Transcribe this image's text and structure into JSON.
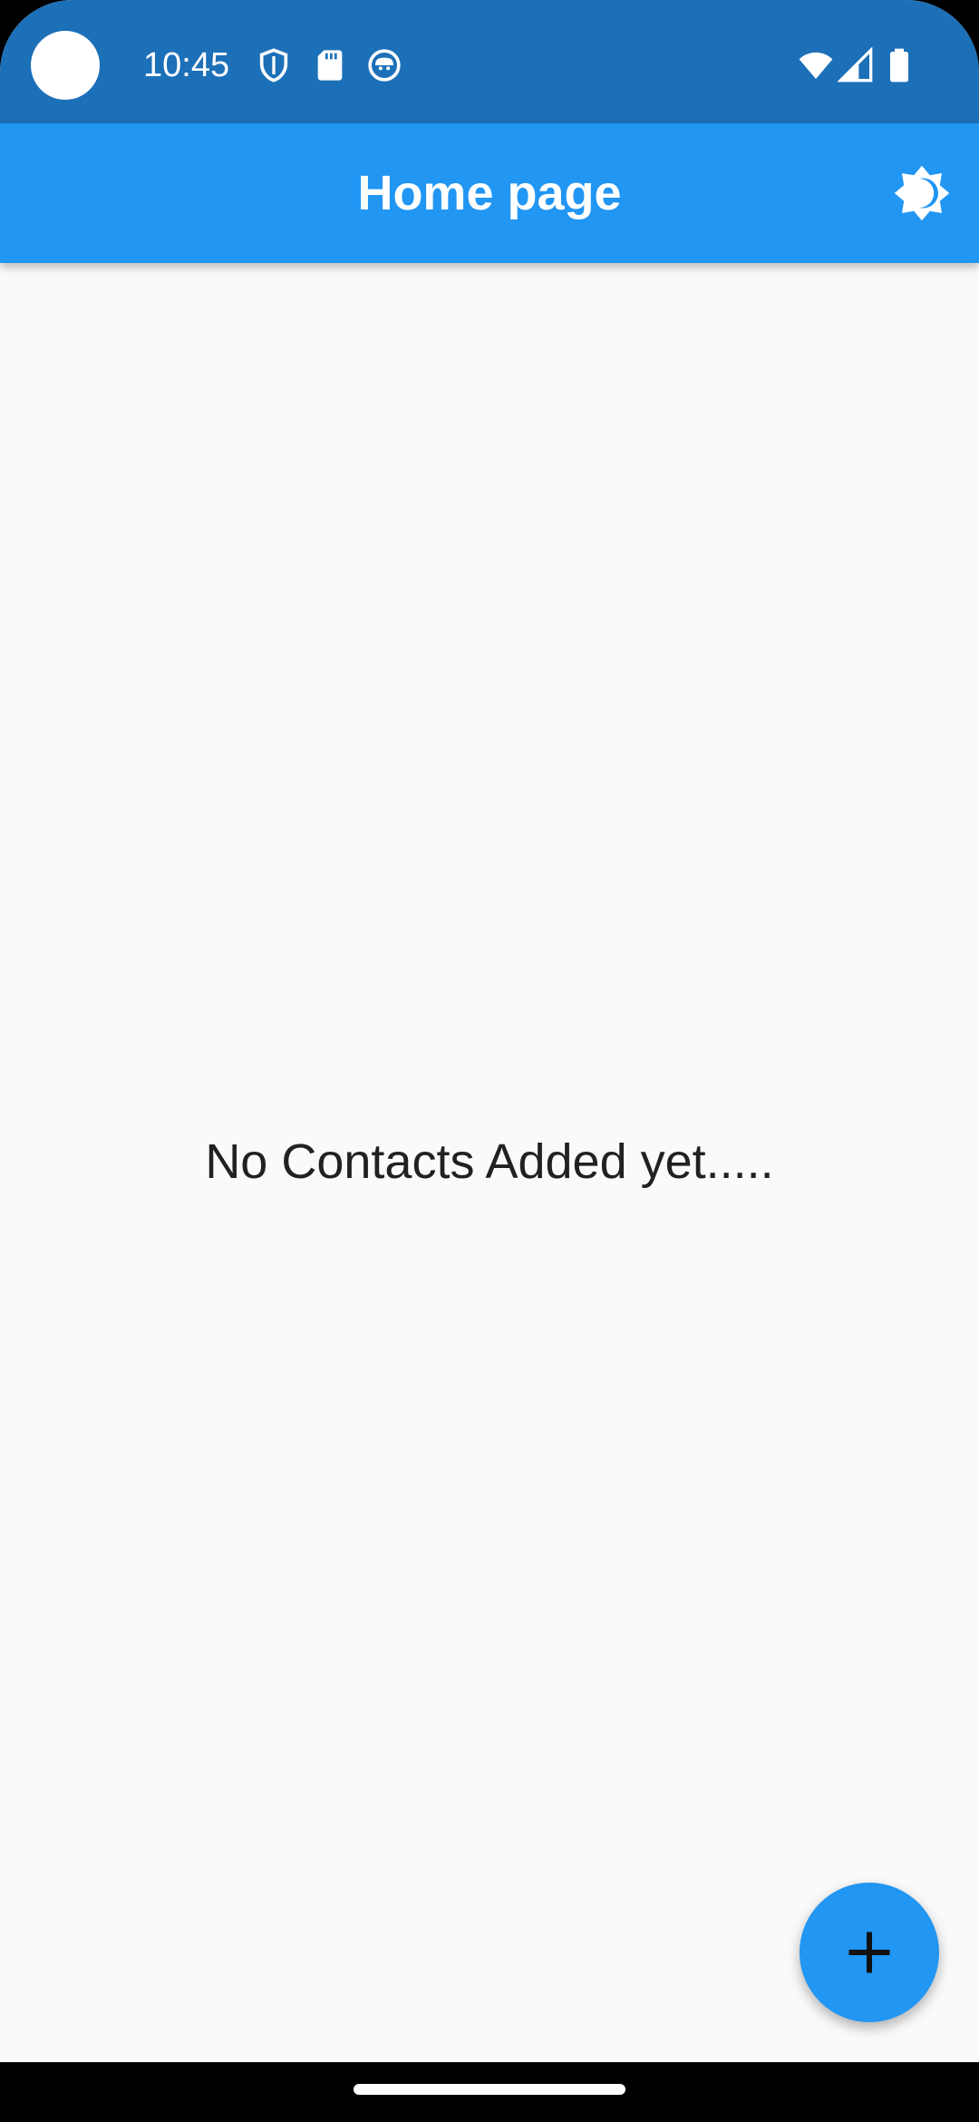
{
  "status_bar": {
    "time": "10:45",
    "left_icons": [
      "shield-icon",
      "sd-card-icon",
      "cat-face-icon"
    ],
    "right_icons": [
      "wifi-icon",
      "signal-icon",
      "battery-icon"
    ]
  },
  "app_bar": {
    "title": "Home page",
    "action_icon": "brightness-icon"
  },
  "body": {
    "empty_message": "No Contacts Added yet....."
  },
  "fab": {
    "icon": "add-icon"
  },
  "colors": {
    "status_bar": "#1c70b8",
    "app_bar": "#2196f3",
    "background": "#fafafa",
    "fab": "#2196f3",
    "text": "#212121"
  }
}
